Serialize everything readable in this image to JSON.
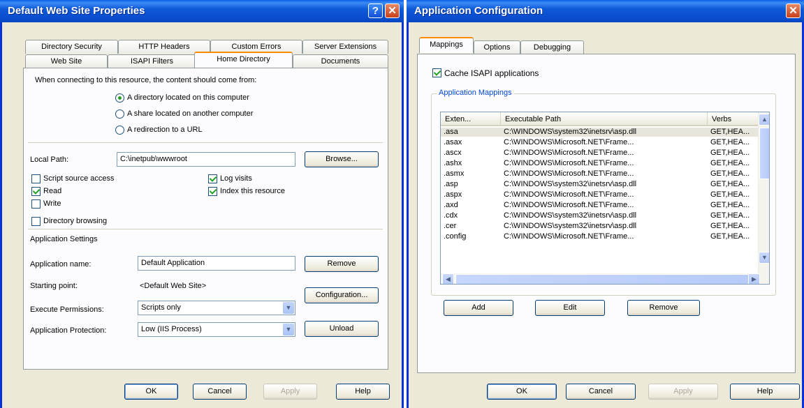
{
  "left_window": {
    "title": "Default Web Site Properties",
    "title_buttons": {
      "help": "?",
      "close": "✕"
    },
    "tabs_row1": [
      "Directory Security",
      "HTTP Headers",
      "Custom Errors",
      "Server Extensions"
    ],
    "tabs_row2": [
      "Web Site",
      "ISAPI Filters",
      "Home Directory",
      "Documents"
    ],
    "active_tab": "Home Directory",
    "intro_text": "When connecting to this resource, the content should come from:",
    "source_options": [
      {
        "label": "A directory located on this computer",
        "selected": true
      },
      {
        "label": "A share located on another computer",
        "selected": false
      },
      {
        "label": "A redirection to a URL",
        "selected": false
      }
    ],
    "local_path_label": "Local Path:",
    "local_path_value": "C:\\inetpub\\wwwroot",
    "browse_label": "Browse...",
    "checkboxes_left": [
      {
        "label": "Script source access",
        "checked": false
      },
      {
        "label": "Read",
        "checked": true
      },
      {
        "label": "Write",
        "checked": false
      },
      {
        "label": "Directory browsing",
        "checked": false
      }
    ],
    "checkboxes_right": [
      {
        "label": "Log visits",
        "checked": true
      },
      {
        "label": "Index this resource",
        "checked": true
      }
    ],
    "app_settings_heading": "Application Settings",
    "app_name_label": "Application name:",
    "app_name_value": "Default Application",
    "remove_label": "Remove",
    "starting_point_label": "Starting point:",
    "starting_point_value": "<Default Web Site>",
    "configuration_label": "Configuration...",
    "exec_perm_label": "Execute Permissions:",
    "exec_perm_value": "Scripts only",
    "app_protection_label": "Application Protection:",
    "app_protection_value": "Low (IIS Process)",
    "unload_label": "Unload",
    "footer_buttons": {
      "ok": "OK",
      "cancel": "Cancel",
      "apply": "Apply",
      "help": "Help"
    }
  },
  "right_window": {
    "title": "Application Configuration",
    "title_buttons": {
      "close": "✕"
    },
    "tabs": [
      "Mappings",
      "Options",
      "Debugging"
    ],
    "active_tab": "Mappings",
    "cache_label": "Cache ISAPI applications",
    "cache_checked": true,
    "group_title": "Application Mappings",
    "columns": [
      "Exten...",
      "Executable Path",
      "Verbs"
    ],
    "rows": [
      [
        ".asa",
        "C:\\WINDOWS\\system32\\inetsrv\\asp.dll",
        "GET,HEA..."
      ],
      [
        ".asax",
        "C:\\WINDOWS\\Microsoft.NET\\Frame...",
        "GET,HEA..."
      ],
      [
        ".ascx",
        "C:\\WINDOWS\\Microsoft.NET\\Frame...",
        "GET,HEA..."
      ],
      [
        ".ashx",
        "C:\\WINDOWS\\Microsoft.NET\\Frame...",
        "GET,HEA..."
      ],
      [
        ".asmx",
        "C:\\WINDOWS\\Microsoft.NET\\Frame...",
        "GET,HEA..."
      ],
      [
        ".asp",
        "C:\\WINDOWS\\system32\\inetsrv\\asp.dll",
        "GET,HEA..."
      ],
      [
        ".aspx",
        "C:\\WINDOWS\\Microsoft.NET\\Frame...",
        "GET,HEA..."
      ],
      [
        ".axd",
        "C:\\WINDOWS\\Microsoft.NET\\Frame...",
        "GET,HEA..."
      ],
      [
        ".cdx",
        "C:\\WINDOWS\\system32\\inetsrv\\asp.dll",
        "GET,HEA..."
      ],
      [
        ".cer",
        "C:\\WINDOWS\\system32\\inetsrv\\asp.dll",
        "GET,HEA..."
      ],
      [
        ".config",
        "C:\\WINDOWS\\Microsoft.NET\\Frame...",
        "GET,HEA..."
      ]
    ],
    "selected_row": ".asa",
    "actions": {
      "add": "Add",
      "edit": "Edit",
      "remove": "Remove"
    },
    "footer_buttons": {
      "ok": "OK",
      "cancel": "Cancel",
      "apply": "Apply",
      "help": "Help"
    }
  },
  "colors": {
    "titlebar": "#0a4fd0",
    "dialog_bg": "#ece9d8",
    "tab_accent": "#ff8c00",
    "group_title": "#0046d5",
    "check_green": "#21a121"
  },
  "icons": {
    "help": "help-icon",
    "close": "close-icon",
    "dropdown": "chevron-down-icon",
    "scroll_up": "scroll-up-icon",
    "scroll_down": "scroll-down-icon",
    "scroll_left": "scroll-left-icon",
    "scroll_right": "scroll-right-icon"
  }
}
